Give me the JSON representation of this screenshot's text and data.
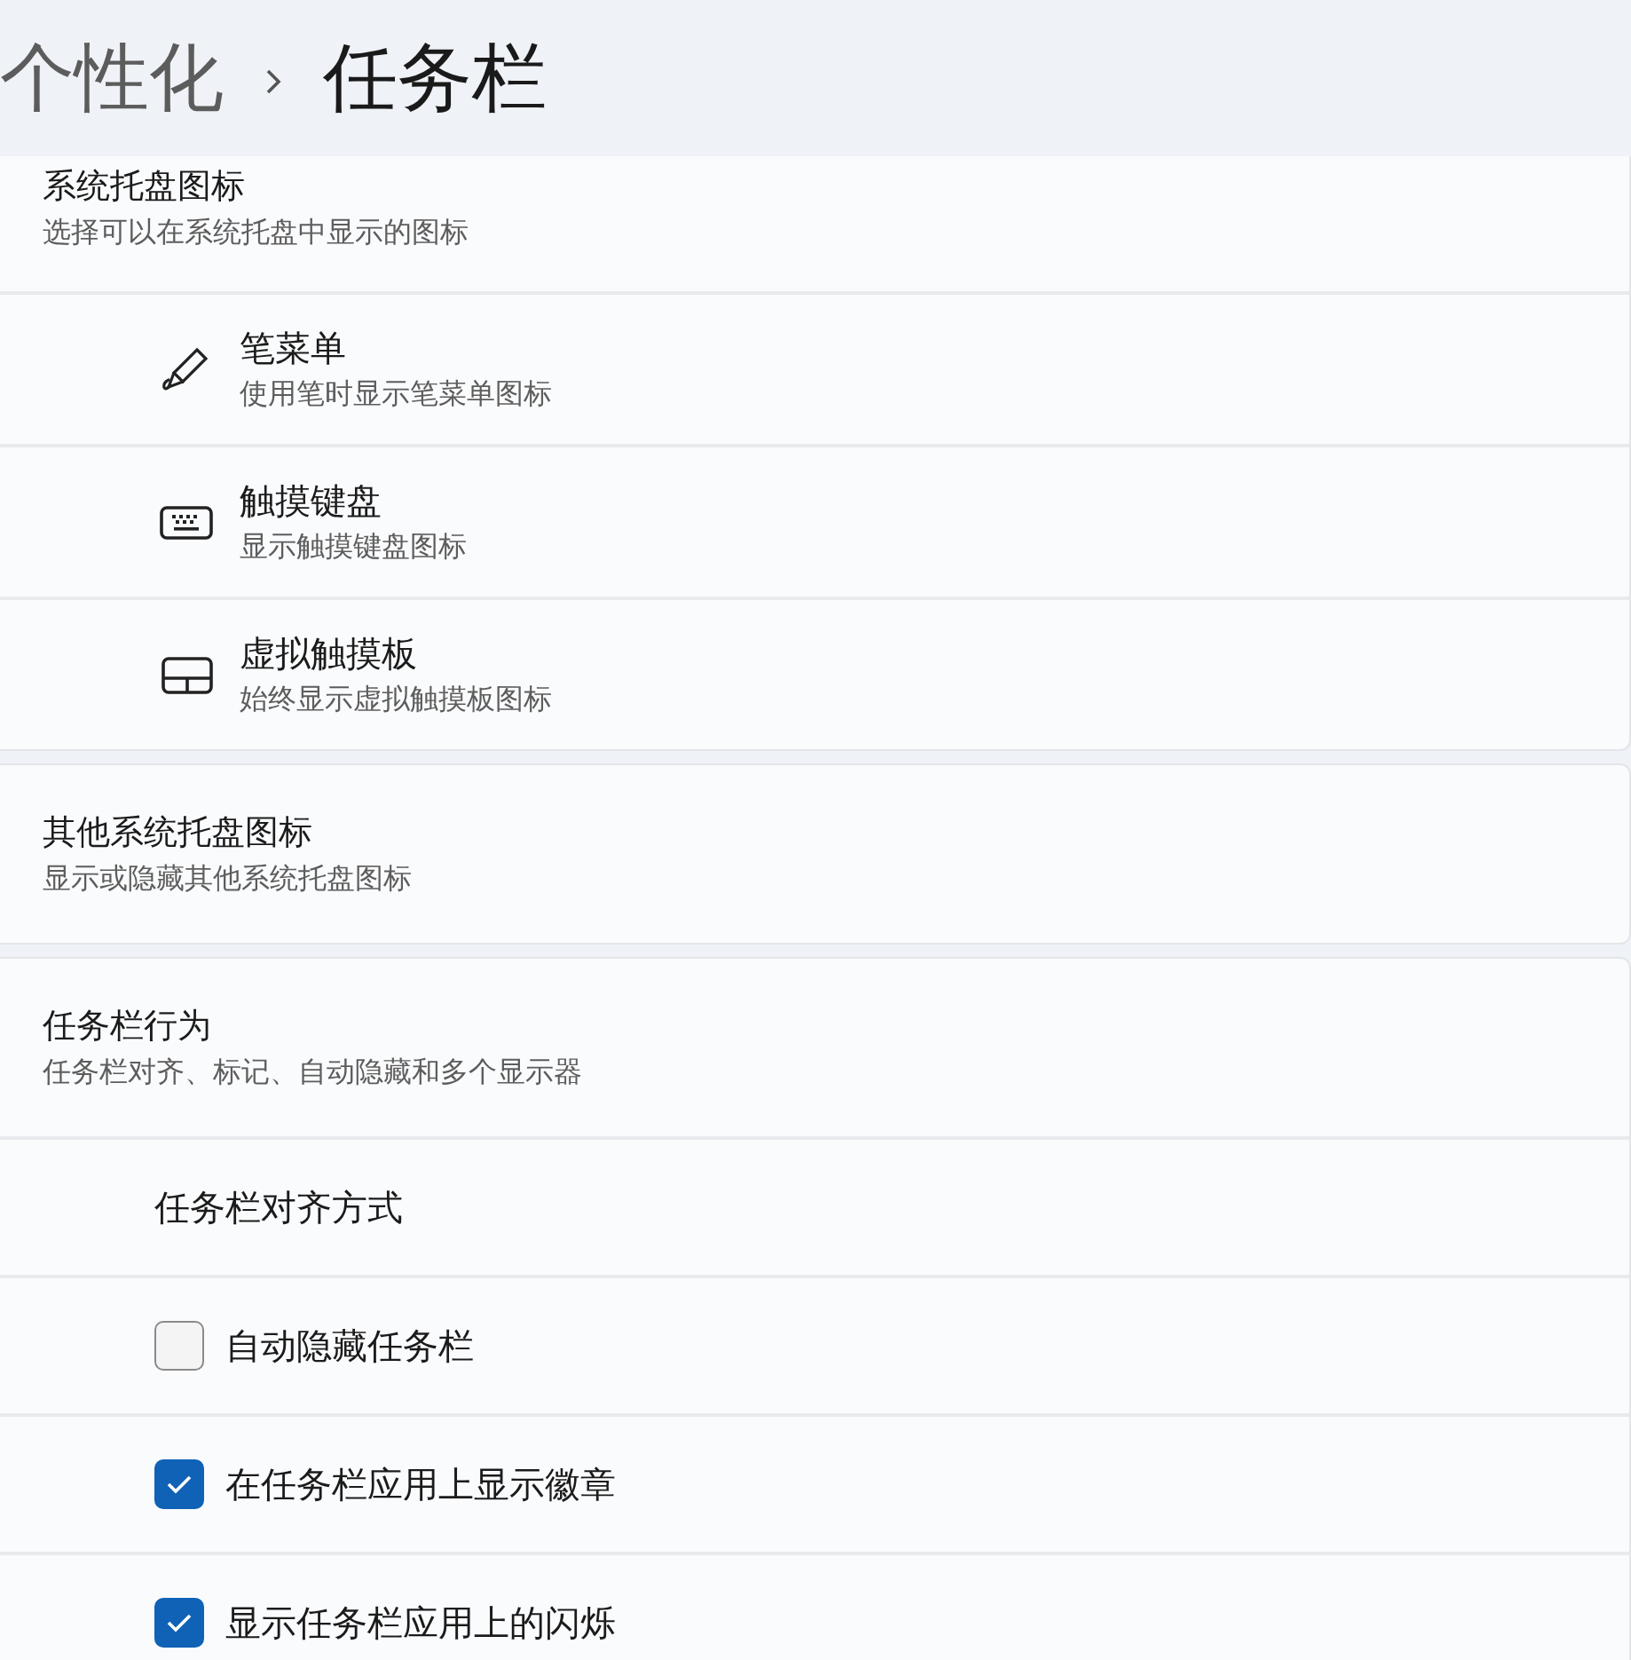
{
  "header": {
    "breadcrumb": [
      {
        "text": "个性化",
        "selected": false
      },
      {
        "text": "任务栏",
        "selected": true
      }
    ]
  },
  "sections": [
    {
      "title": "系统托盘图标",
      "subtitle": "选择可以在系统托盘中显示的图标",
      "items": [
        {
          "kind": "icon",
          "label": "笔菜单",
          "subtitle": "使用笔时显示笔菜单图标"
        },
        {
          "kind": "icon",
          "label": "触摸键盘",
          "subtitle": "显示触摸键盘图标"
        },
        {
          "kind": "icon",
          "label": "虚拟触摸板",
          "subtitle": "始终显示虚拟触摸板图标"
        }
      ]
    },
    {
      "title": "其他系统托盘图标",
      "subtitle": "显示或隐藏其他系统托盘图标"
    },
    {
      "title": "任务栏行为",
      "subtitle": "任务栏对齐、标记、自动隐藏和多个显示器",
      "items": [
        {
          "kind": "plain",
          "label": "任务栏对齐方式"
        },
        {
          "kind": "checkbox",
          "label": "自动隐藏任务栏",
          "checked": false
        },
        {
          "kind": "checkbox",
          "label": "在任务栏应用上显示徽章",
          "checked": true
        },
        {
          "kind": "checkbox",
          "label": "显示任务栏应用上的闪烁",
          "checked": true
        }
      ]
    }
  ]
}
